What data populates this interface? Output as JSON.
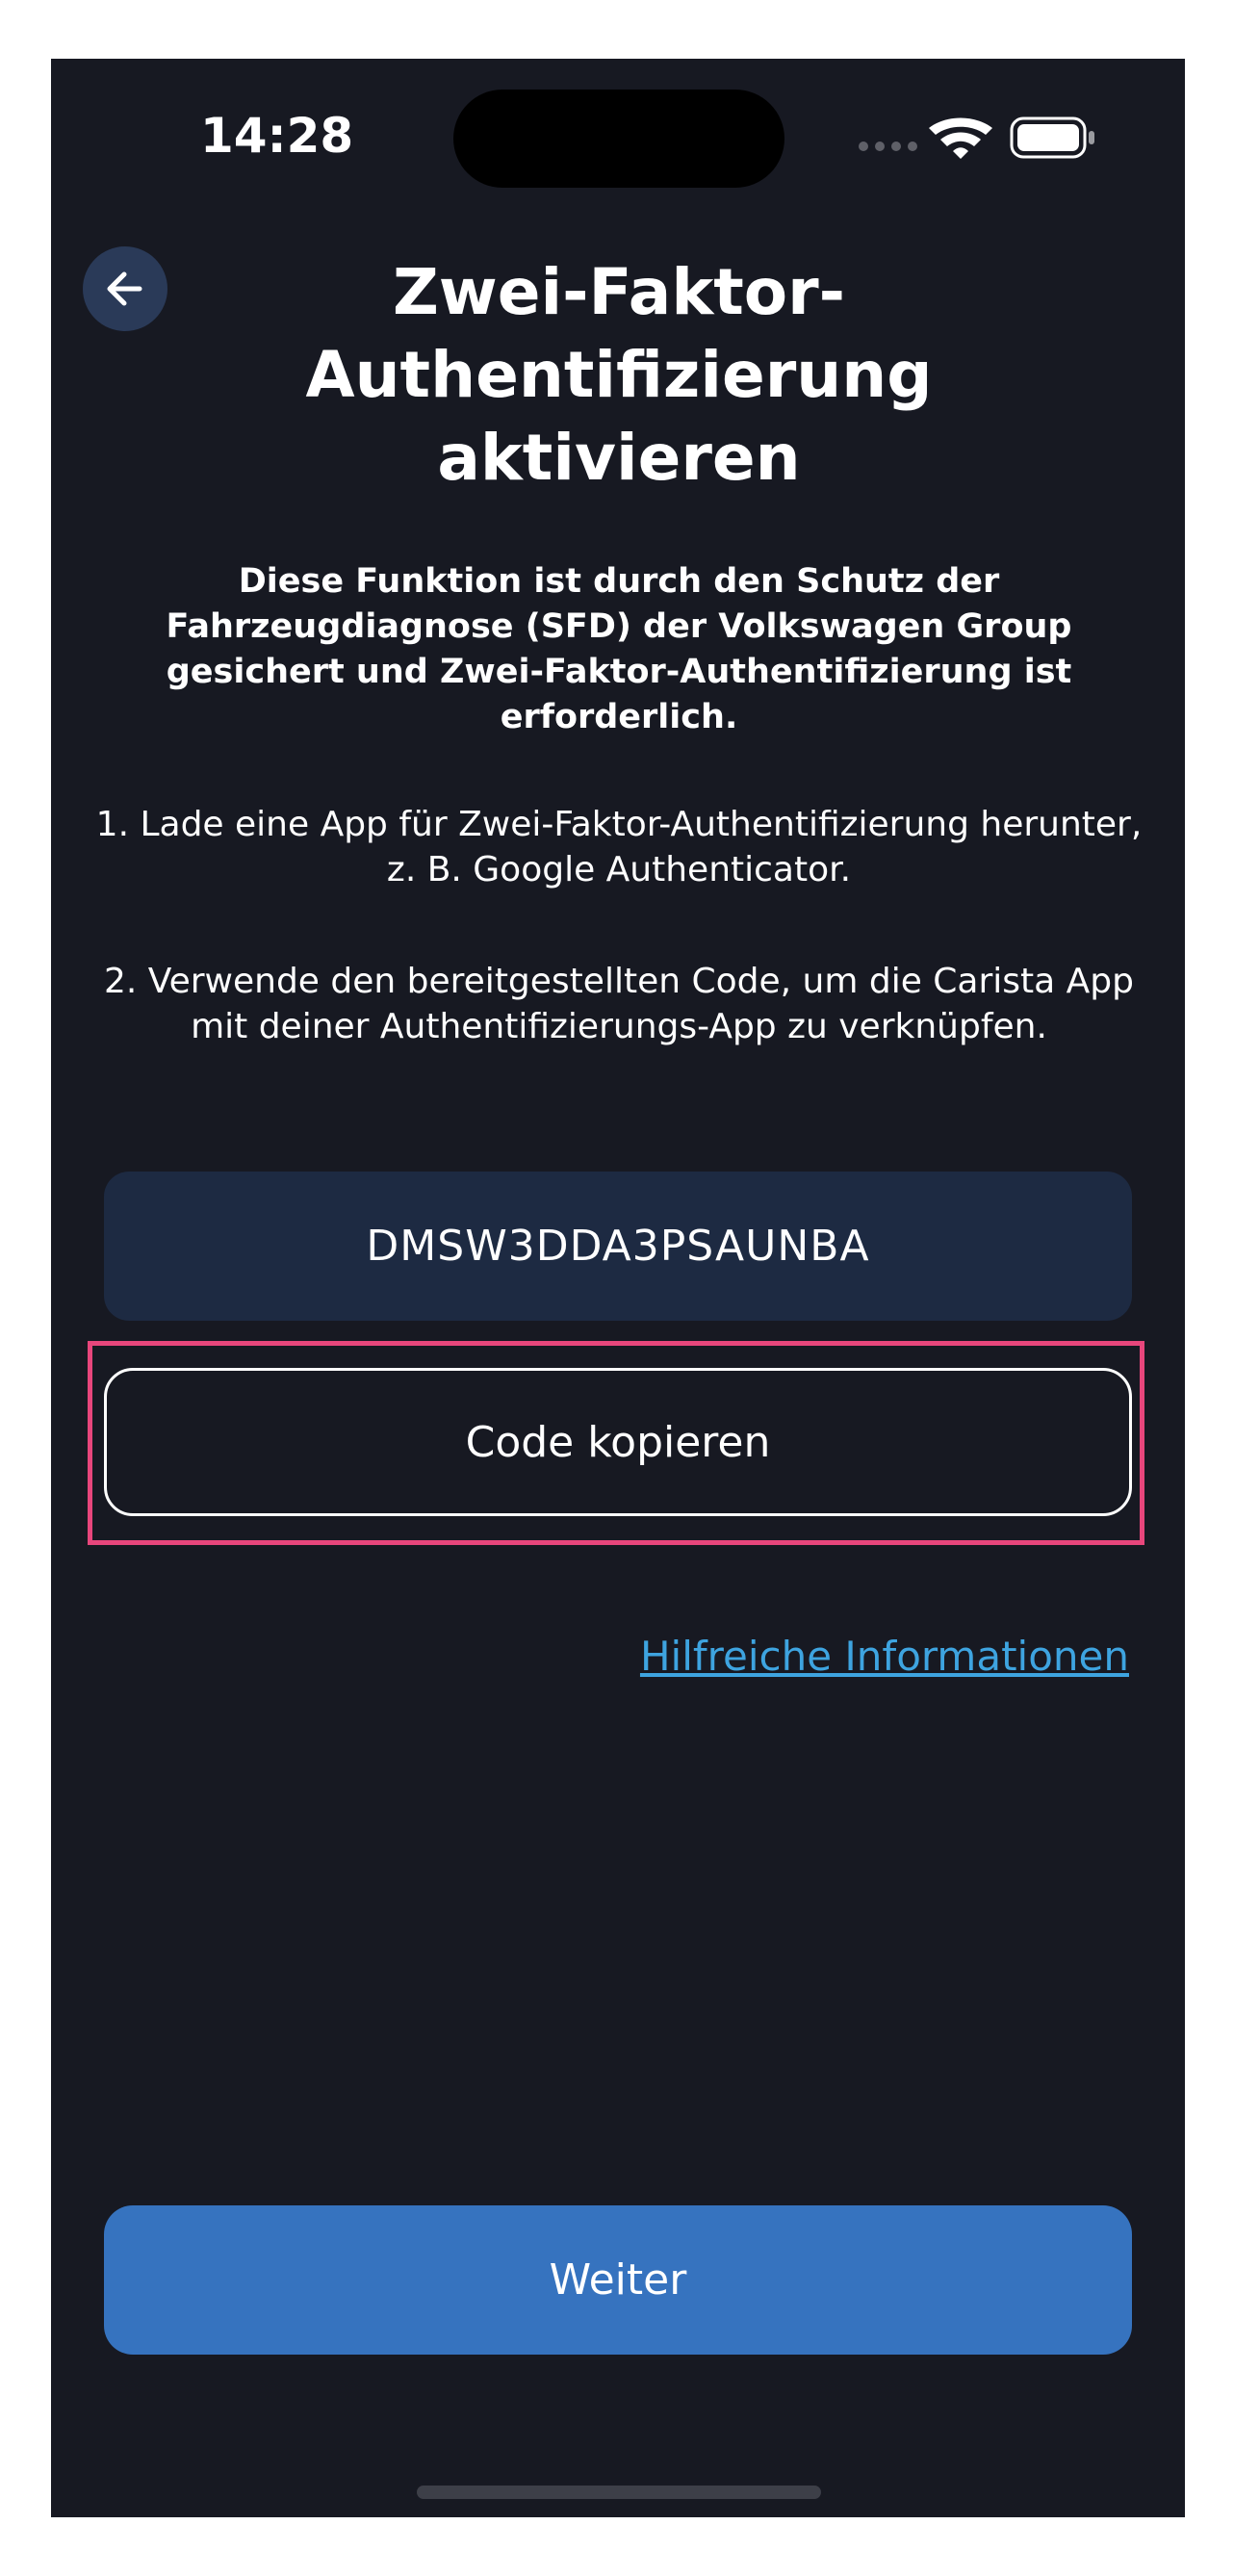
{
  "status_bar": {
    "time": "14:28"
  },
  "header": {
    "title": "Zwei-Faktor-Authentifizierung aktivieren"
  },
  "content": {
    "notice": "Diese Funktion ist durch den Schutz der Fahrzeugdiagnose (SFD) der Volkswagen Group gesichert und Zwei-Faktor-Authentifizierung ist erforderlich.",
    "step1": "1. Lade eine App für Zwei-Faktor-Authentifizierung herunter, z. B. Google Authenticator.",
    "step2": "2. Verwende den bereitgestellten Code, um die Carista App mit deiner Authentifizierungs-App zu verknüpfen.",
    "code": "DMSW3DDA3PSAUNBA",
    "copy_label": "Code kopieren",
    "help_link": "Hilfreiche Informationen"
  },
  "footer": {
    "next_label": "Weiter"
  },
  "colors": {
    "background": "#171922",
    "code_box": "#1d2a42",
    "primary_button": "#3673bf",
    "link": "#3ea4e0",
    "highlight": "#e8467c"
  },
  "icons": {
    "back": "arrow-left-icon",
    "signal": "cellular-signal-icon",
    "wifi": "wifi-icon",
    "battery": "battery-icon"
  }
}
